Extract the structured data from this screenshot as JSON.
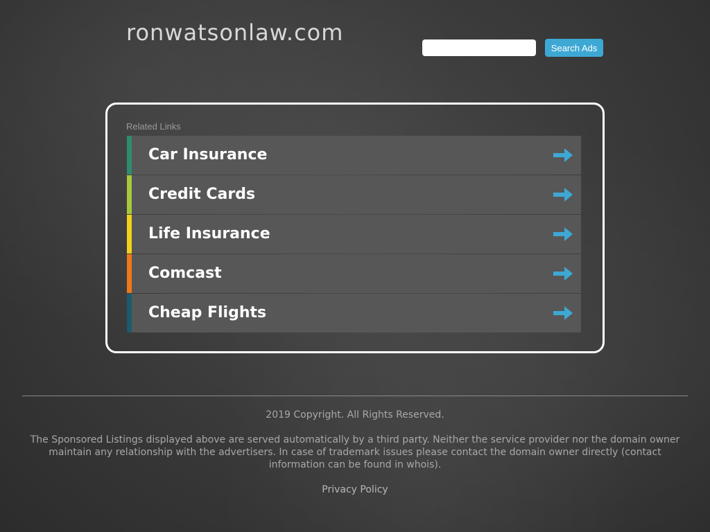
{
  "header": {
    "site_title": "ronwatsonlaw.com",
    "search_placeholder": "",
    "search_button_label": "Search Ads"
  },
  "related_links": {
    "heading": "Related Links",
    "items": [
      {
        "label": "Car Insurance",
        "stripe_color": "#2e8b6e"
      },
      {
        "label": "Credit Cards",
        "stripe_color": "#a6c93d"
      },
      {
        "label": "Life Insurance",
        "stripe_color": "#f2d21b"
      },
      {
        "label": "Comcast",
        "stripe_color": "#f07818"
      },
      {
        "label": "Cheap Flights",
        "stripe_color": "#1e5a6e"
      }
    ],
    "arrow_icon": "arrow-right-icon",
    "arrow_color": "#3ea8d4"
  },
  "footer": {
    "copyright": "2019 Copyright. All Rights Reserved.",
    "disclaimer": "The Sponsored Listings displayed above are served automatically by a third party. Neither the service provider nor the domain owner maintain any relationship with the advertisers. In case of trademark issues please contact the domain owner directly (contact information can be found in whois).",
    "privacy_link": "Privacy Policy"
  }
}
